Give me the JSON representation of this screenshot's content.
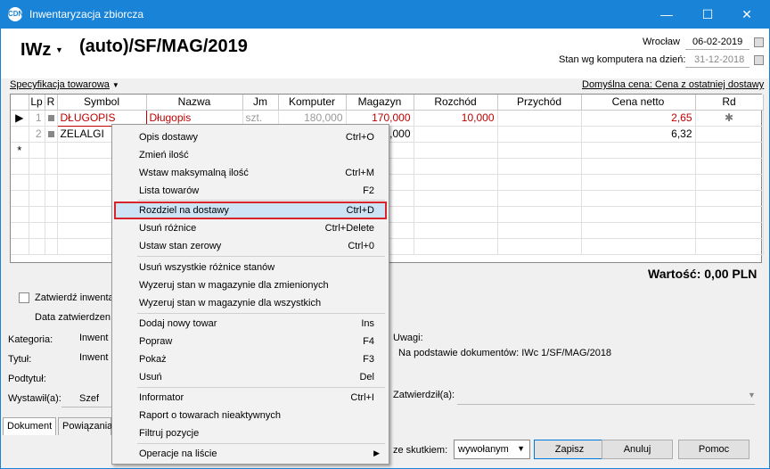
{
  "window": {
    "title": "Inwentaryzacja zbiorcza",
    "app_icon": "CDN"
  },
  "doc": {
    "type": "IWz",
    "number": "(auto)/SF/MAG/2019",
    "place": "Wrocław",
    "date": "06-02-2019",
    "stan_label": "Stan wg komputera na dzień:",
    "stan_date": "31-12-2018"
  },
  "spec": {
    "label": "Specyfikacja towarowa",
    "default_price": "Domyślna cena: Cena z ostatniej dostawy"
  },
  "grid": {
    "columns": [
      "Lp",
      "R",
      "Symbol",
      "Nazwa",
      "Jm",
      "Komputer",
      "Magazyn",
      "Rozchód",
      "Przychód",
      "Cena netto",
      "Rd"
    ],
    "rows": [
      {
        "lp": "1",
        "symbol": "DŁUGOPIS",
        "nazwa": "Długopis",
        "jm": "szt.",
        "komputer": "180,000",
        "magazyn": "170,000",
        "rozchod": "10,000",
        "przychod": "",
        "cena": "2,65"
      },
      {
        "lp": "2",
        "symbol": "ZELALGI",
        "nazwa": "",
        "jm": "",
        "komputer": "",
        "magazyn": ",000",
        "rozchod": "",
        "przychod": "",
        "cena": "6,32"
      }
    ],
    "new_row_marker": "*"
  },
  "footer": {
    "wartosc": "Wartość: 0,00 PLN",
    "zatwierdz_label": "Zatwierdź inwenta",
    "data_zatw_label": "Data zatwierdzen",
    "kategoria_label": "Kategoria:",
    "kategoria_value": "Inwent",
    "tytul_label": "Tytuł:",
    "tytul_value": "Inwent",
    "podtytul_label": "Podtytuł:",
    "wystawil_label": "Wystawił(a):",
    "wystawil_value": "Szef",
    "uwagi_label": "Uwagi:",
    "uwagi_value": "Na podstawie dokumentów: IWc 1/SF/MAG/2018",
    "zatwierdzil_label": "Zatwierdził(a):",
    "skutkiem_label": "ze skutkiem:",
    "skutkiem_value": "wywołanym"
  },
  "tabs": [
    "Dokument",
    "Powiązania"
  ],
  "buttons": {
    "zapisz": "Zapisz",
    "anuluj": "Anuluj",
    "pomoc": "Pomoc"
  },
  "context_menu": {
    "items": [
      {
        "label": "Opis dostawy",
        "shortcut": "Ctrl+O"
      },
      {
        "label": "Zmień ilość",
        "shortcut": ""
      },
      {
        "label": "Wstaw maksymalną ilość",
        "shortcut": "Ctrl+M"
      },
      {
        "label": "Lista towarów",
        "shortcut": "F2"
      },
      {
        "label": "Rozdziel na dostawy",
        "shortcut": "Ctrl+D"
      },
      {
        "label": "Usuń różnice",
        "shortcut": "Ctrl+Delete"
      },
      {
        "label": "Ustaw stan zerowy",
        "shortcut": "Ctrl+0"
      },
      {
        "label": "Usuń wszystkie różnice stanów",
        "shortcut": ""
      },
      {
        "label": "Wyzeruj stan w magazynie dla zmienionych",
        "shortcut": ""
      },
      {
        "label": "Wyzeruj stan w magazynie dla wszystkich",
        "shortcut": ""
      },
      {
        "label": "Dodaj nowy towar",
        "shortcut": "Ins"
      },
      {
        "label": "Popraw",
        "shortcut": "F4"
      },
      {
        "label": "Pokaż",
        "shortcut": "F3"
      },
      {
        "label": "Usuń",
        "shortcut": "Del"
      },
      {
        "label": "Informator",
        "shortcut": "Ctrl+I"
      },
      {
        "label": "Raport o towarach nieaktywnych",
        "shortcut": ""
      },
      {
        "label": "Filtruj pozycje",
        "shortcut": ""
      },
      {
        "label": "Operacje na liście",
        "shortcut": ""
      }
    ]
  },
  "colors": {
    "titlebar": "#1883d7",
    "highlight_border": "#d7242d",
    "red_text": "#c00000"
  }
}
